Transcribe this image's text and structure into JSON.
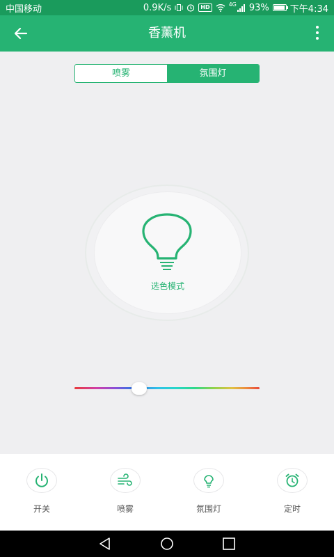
{
  "status_bar": {
    "carrier": "中国移动",
    "speed": "0.9K/s",
    "hd": "HD",
    "signal": "4G",
    "battery": "93%",
    "time": "下午4:34"
  },
  "app_bar": {
    "title": "香薰机"
  },
  "tabs": [
    {
      "label": "喷雾",
      "active": false
    },
    {
      "label": "氛围灯",
      "active": true
    }
  ],
  "light": {
    "mode_label": "选色模式"
  },
  "color_slider": {
    "position_fraction": 0.35
  },
  "actions": [
    {
      "label": "开关",
      "icon": "power-icon"
    },
    {
      "label": "喷雾",
      "icon": "mist-icon"
    },
    {
      "label": "氛围灯",
      "icon": "bulb-icon"
    },
    {
      "label": "定时",
      "icon": "alarm-clock-icon"
    }
  ],
  "colors": {
    "primary": "#26b373",
    "status_bar": "#1a9b5c"
  }
}
